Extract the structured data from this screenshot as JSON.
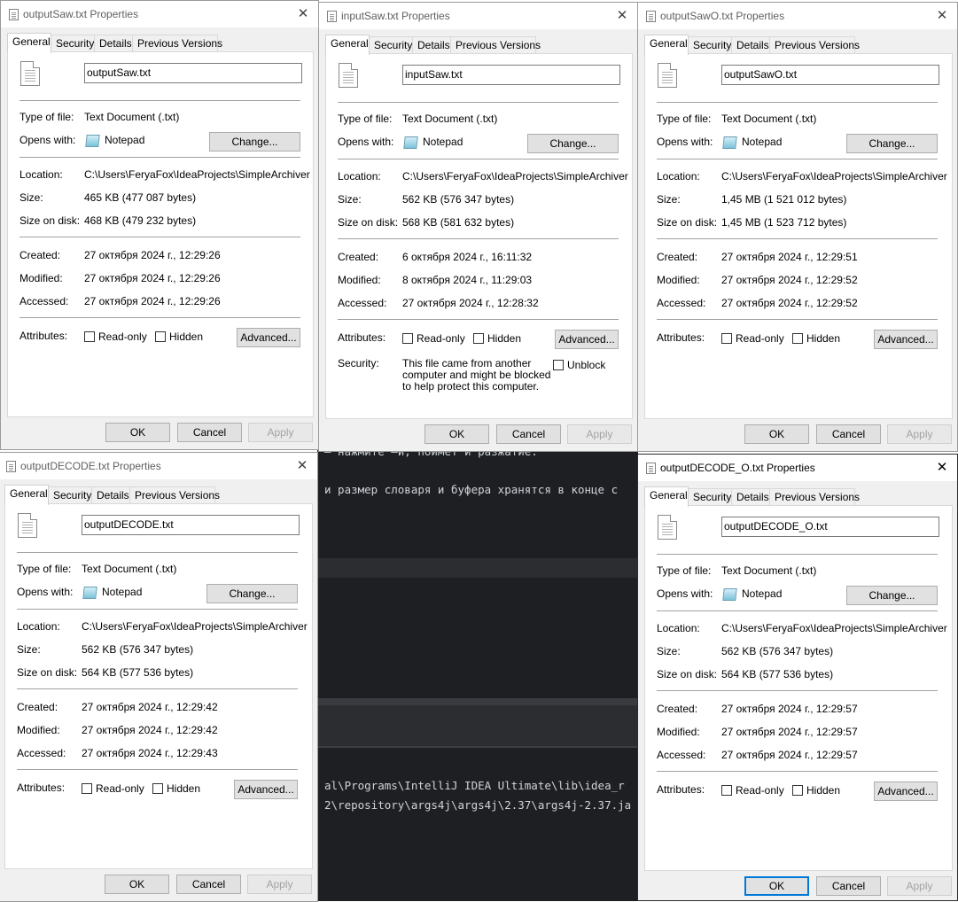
{
  "background_app": {
    "lines": [
      "— нажмите —и, поймет и разжатие.",
      "и размер словаря и буфера хранятся в конце с",
      "al\\Programs\\IntelliJ IDEA Ultimate\\lib\\idea_r",
      "2\\repository\\args4j\\args4j\\2.37\\args4j-2.37.ja"
    ]
  },
  "common": {
    "tabs": [
      "General",
      "Security",
      "Details",
      "Previous Versions"
    ],
    "labels": {
      "type_of_file": "Type of file:",
      "opens_with": "Opens with:",
      "location": "Location:",
      "size": "Size:",
      "size_on_disk": "Size on disk:",
      "created": "Created:",
      "modified": "Modified:",
      "accessed": "Accessed:",
      "attributes": "Attributes:",
      "security": "Security:"
    },
    "type_value": "Text Document (.txt)",
    "opens_app": "Notepad",
    "location_value": "C:\\Users\\FeryaFox\\IdeaProjects\\SimpleArchiver",
    "change_label": "Change...",
    "readonly_label": "Read-only",
    "hidden_label": "Hidden",
    "advanced_label": "Advanced...",
    "ok_label": "OK",
    "cancel_label": "Cancel",
    "apply_label": "Apply",
    "close_glyph": "✕",
    "security_text": "This file came from another computer and might be blocked to help protect this computer.",
    "unblock_label": "Unblock"
  },
  "dialogs": [
    {
      "title": "outputSaw.txt Properties",
      "filename": "outputSaw.txt",
      "size": "465 KB (477 087 bytes)",
      "size_on_disk": "468 KB (479 232 bytes)",
      "created": "27 октября 2024 г., 12:29:26",
      "modified": "27 октября 2024 г., 12:29:26",
      "accessed": "27 октября 2024 г., 12:29:26"
    },
    {
      "title": "inputSaw.txt Properties",
      "filename": "inputSaw.txt",
      "size": "562 KB (576 347 bytes)",
      "size_on_disk": "568 KB (581 632 bytes)",
      "created": "6 октября 2024 г., 16:11:32",
      "modified": "8 октября 2024 г., 11:29:03",
      "accessed": "27 октября 2024 г., 12:28:32"
    },
    {
      "title": "outputSawO.txt Properties",
      "filename": "outputSawO.txt",
      "size": "1,45 MB (1 521 012 bytes)",
      "size_on_disk": "1,45 MB (1 523 712 bytes)",
      "created": "27 октября 2024 г., 12:29:51",
      "modified": "27 октября 2024 г., 12:29:52",
      "accessed": "27 октября 2024 г., 12:29:52"
    },
    {
      "title": "outputDECODE.txt Properties",
      "filename": "outputDECODE.txt",
      "size": "562 KB (576 347 bytes)",
      "size_on_disk": "564 KB (577 536 bytes)",
      "created": "27 октября 2024 г., 12:29:42",
      "modified": "27 октября 2024 г., 12:29:42",
      "accessed": "27 октября 2024 г., 12:29:43"
    },
    {
      "title": "outputDECODE_O.txt Properties",
      "filename": "outputDECODE_O.txt",
      "size": "562 KB (576 347 bytes)",
      "size_on_disk": "564 KB (577 536 bytes)",
      "created": "27 октября 2024 г., 12:29:57",
      "modified": "27 октября 2024 г., 12:29:57",
      "accessed": "27 октября 2024 г., 12:29:57"
    }
  ]
}
